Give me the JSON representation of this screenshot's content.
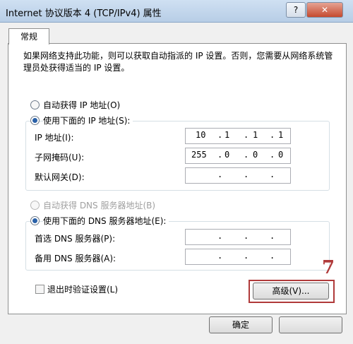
{
  "window": {
    "title": "Internet 协议版本 4 (TCP/IPv4) 属性",
    "help_label": "?",
    "close_label": "✕"
  },
  "tabs": [
    {
      "label": "常规"
    }
  ],
  "description": "如果网络支持此功能，则可以获取自动指派的 IP 设置。否则，您需要从网络系统管理员处获得适当的 IP 设置。",
  "ip": {
    "auto_label": "自动获得 IP 地址(O)",
    "manual_label": "使用下面的 IP 地址(S):",
    "address_label": "IP 地址(I):",
    "address": [
      "10",
      "1",
      "1",
      "1"
    ],
    "mask_label": "子网掩码(U):",
    "mask": [
      "255",
      "0",
      "0",
      "0"
    ],
    "gateway_label": "默认网关(D):",
    "gateway": [
      "",
      "",
      "",
      ""
    ]
  },
  "dns": {
    "auto_label": "自动获得 DNS 服务器地址(B)",
    "manual_label": "使用下面的 DNS 服务器地址(E):",
    "preferred_label": "首选 DNS 服务器(P):",
    "preferred": [
      "",
      "",
      "",
      ""
    ],
    "alternate_label": "备用 DNS 服务器(A):",
    "alternate": [
      "",
      "",
      "",
      ""
    ]
  },
  "validate_label": "退出时验证设置(L)",
  "advanced_label": "高级(V)...",
  "ok_label": "确定",
  "annotation_number": "7",
  "colors": {
    "titlebar": "#c3d6ec",
    "highlight": "#b03a3a",
    "radio_dot": "#2a61a8"
  }
}
